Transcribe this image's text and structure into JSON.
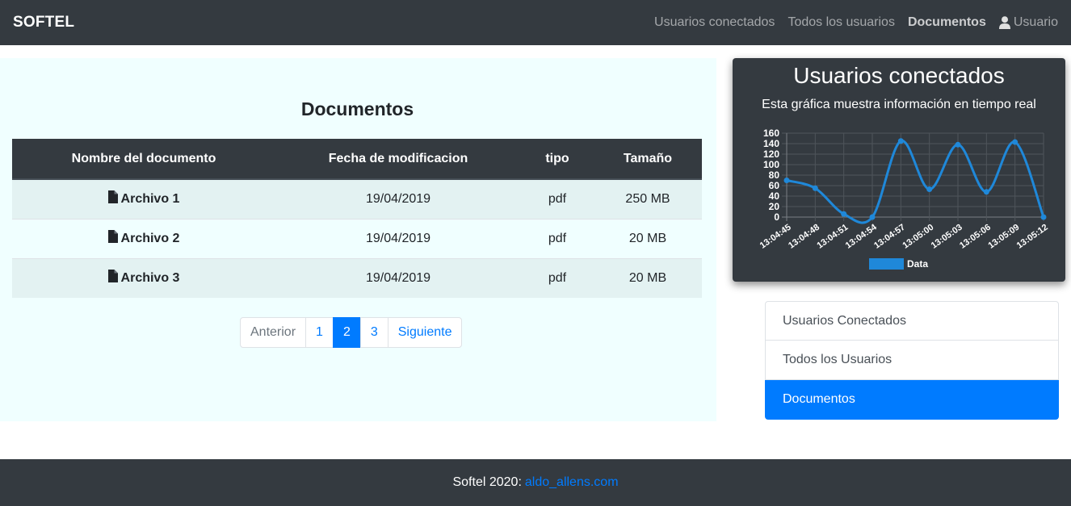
{
  "navbar": {
    "brand": "SOFTEL",
    "links": [
      {
        "label": "Usuarios conectados"
      },
      {
        "label": "Todos los usuarios"
      },
      {
        "label": "Documentos",
        "active": true
      },
      {
        "label": "Usuario",
        "icon": "user-icon"
      }
    ]
  },
  "main": {
    "title": "Documentos",
    "table": {
      "headers": [
        "Nombre del documento",
        "Fecha de modificacion",
        "tipo",
        "Tamaño"
      ],
      "rows": [
        {
          "name": "Archivo 1",
          "date": "19/04/2019",
          "type": "pdf",
          "size": "250 MB"
        },
        {
          "name": "Archivo 2",
          "date": "19/04/2019",
          "type": "pdf",
          "size": "20 MB"
        },
        {
          "name": "Archivo 3",
          "date": "19/04/2019",
          "type": "pdf",
          "size": "20 MB"
        }
      ],
      "row_icon": "file-icon"
    },
    "pagination": {
      "prev": "Anterior",
      "pages": [
        "1",
        "2",
        "3"
      ],
      "active_page": "2",
      "next": "Siguiente"
    }
  },
  "sidebar": {
    "chart_title": "Usuarios conectados",
    "chart_subtitle": "Esta gráfica muestra información en tiempo real",
    "menu": [
      {
        "label": "Usuarios Conectados"
      },
      {
        "label": "Todos los Usuarios"
      },
      {
        "label": "Documentos",
        "active": true
      }
    ]
  },
  "footer": {
    "text": "Softel 2020:",
    "link": "aldo_allens.com"
  },
  "colors": {
    "dark": "#343a40",
    "accent": "#007bff",
    "panel_bg": "#f0ffff",
    "series": "#1f88d9"
  },
  "chart_data": {
    "type": "line",
    "x": [
      "13:04:45",
      "13:04:48",
      "13:04:51",
      "13:04:54",
      "13:04:57",
      "13:05:00",
      "13:05:03",
      "13:05:06",
      "13:05:09",
      "13:05:12"
    ],
    "series": [
      {
        "name": "Data",
        "values": [
          70,
          55,
          6,
          0,
          145,
          53,
          138,
          48,
          143,
          0
        ]
      }
    ],
    "ylim": [
      0,
      160
    ],
    "yticks": [
      0,
      20,
      40,
      60,
      80,
      100,
      120,
      140,
      160
    ],
    "grid": true,
    "legend": "bottom"
  }
}
